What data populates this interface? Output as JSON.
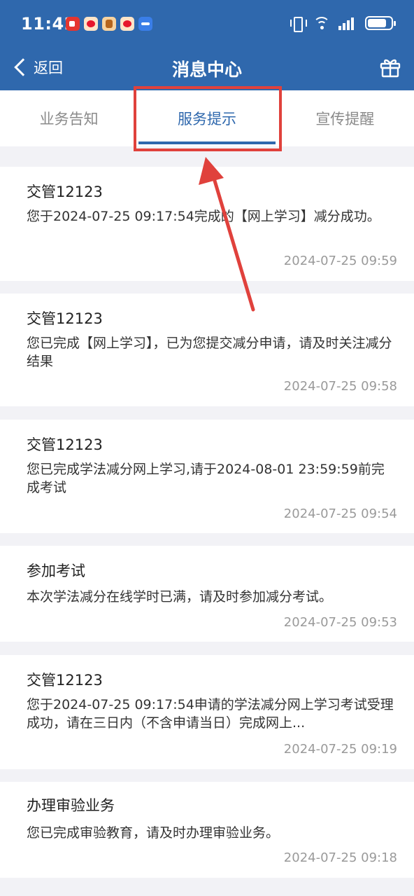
{
  "status_bar": {
    "time": "11:42",
    "app_icons": [
      "video-app-icon",
      "weibo-icon",
      "game-app-icon",
      "weibo-icon",
      "browser-app-icon"
    ]
  },
  "nav": {
    "back_label": "返回",
    "title": "消息中心",
    "right_icon": "gift-icon"
  },
  "tabs": [
    {
      "label": "业务告知",
      "active": false
    },
    {
      "label": "服务提示",
      "active": true
    },
    {
      "label": "宣传提醒",
      "active": false
    }
  ],
  "messages": [
    {
      "title": "交管12123",
      "body": "您于2024-07-25 09:17:54完成的【网上学习】减分成功。",
      "time": "2024-07-25 09:59"
    },
    {
      "title": "交管12123",
      "body": "您已完成【网上学习】，已为您提交减分申请，请及时关注减分结果",
      "time": "2024-07-25 09:58"
    },
    {
      "title": "交管12123",
      "body": "您已完成学法减分网上学习,请于2024-08-01 23:59:59前完成考试",
      "time": "2024-07-25 09:54"
    },
    {
      "title": "参加考试",
      "body": "本次学法减分在线学时已满，请及时参加减分考试。",
      "time": "2024-07-25 09:53"
    },
    {
      "title": "交管12123",
      "body": "您于2024-07-25 09:17:54申请的学法减分网上学习考试受理成功，请在三日内（不含申请当日）完成网上...",
      "time": "2024-07-25 09:19"
    },
    {
      "title": "办理审验业务",
      "body": "您已完成审验教育，请及时办理审验业务。",
      "time": "2024-07-25 09:18"
    }
  ],
  "colors": {
    "header": "#2f68ad",
    "active_tab": "#2f68ad",
    "annotation": "#e0413c",
    "background": "#f2f2f6"
  }
}
